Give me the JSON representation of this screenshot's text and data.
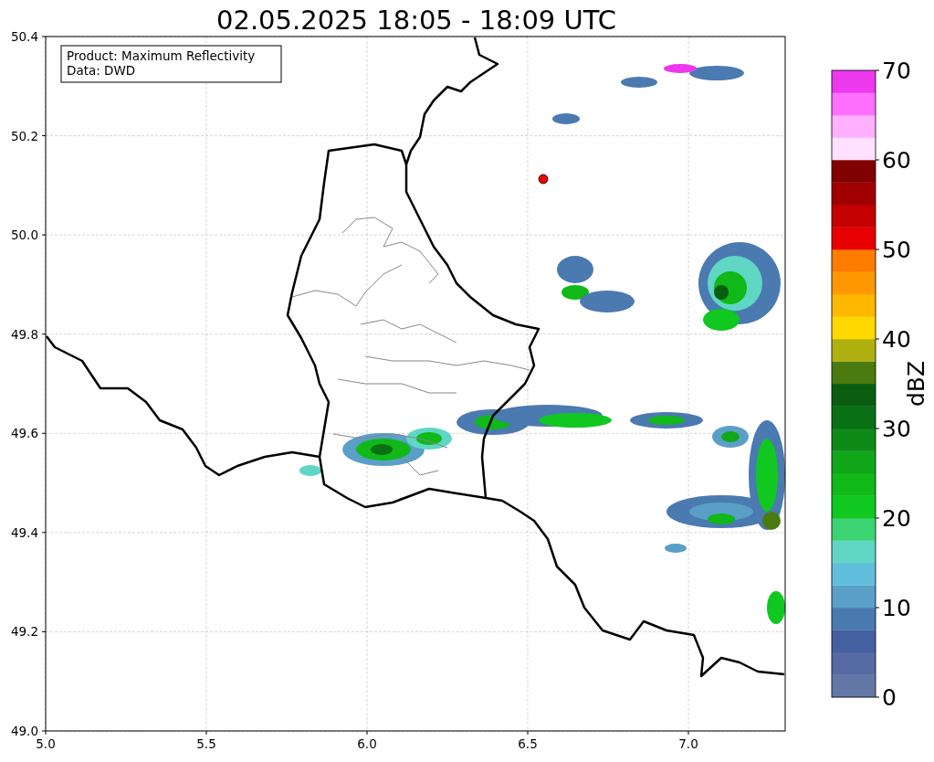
{
  "title": "02.05.2025 18:05 - 18:09 UTC",
  "info_box": [
    "Product: Maximum Reflectivity",
    "Data: DWD"
  ],
  "x_ticks": [
    "5.0",
    "5.5",
    "6.0",
    "6.5",
    "7.0"
  ],
  "y_ticks": [
    "50.4",
    "50.2",
    "50.0",
    "49.8",
    "49.6",
    "49.4",
    "49.2",
    "49.0"
  ],
  "colorbar": {
    "label": "dBZ",
    "ticks": [
      "70",
      "60",
      "50",
      "40",
      "30",
      "20",
      "10",
      "0"
    ],
    "segments": [
      {
        "color": "#6478a8"
      },
      {
        "color": "#566ba3"
      },
      {
        "color": "#4460a0"
      },
      {
        "color": "#4a7ab0"
      },
      {
        "color": "#5a9fc8"
      },
      {
        "color": "#62bedd"
      },
      {
        "color": "#60d6c4"
      },
      {
        "color": "#3cd472"
      },
      {
        "color": "#10c820"
      },
      {
        "color": "#10b818"
      },
      {
        "color": "#10a818"
      },
      {
        "color": "#0e8a18"
      },
      {
        "color": "#0a7016"
      },
      {
        "color": "#0a5c10"
      },
      {
        "color": "#4a7a10"
      },
      {
        "color": "#b0b010"
      },
      {
        "color": "#ffd800"
      },
      {
        "color": "#ffb800"
      },
      {
        "color": "#ff9800"
      },
      {
        "color": "#ff7c00"
      },
      {
        "color": "#e80000"
      },
      {
        "color": "#c40000"
      },
      {
        "color": "#a00000"
      },
      {
        "color": "#800000"
      },
      {
        "color": "#ffe0ff"
      },
      {
        "color": "#ffb0ff"
      },
      {
        "color": "#ff70ff"
      },
      {
        "color": "#ee38ee"
      }
    ]
  }
}
